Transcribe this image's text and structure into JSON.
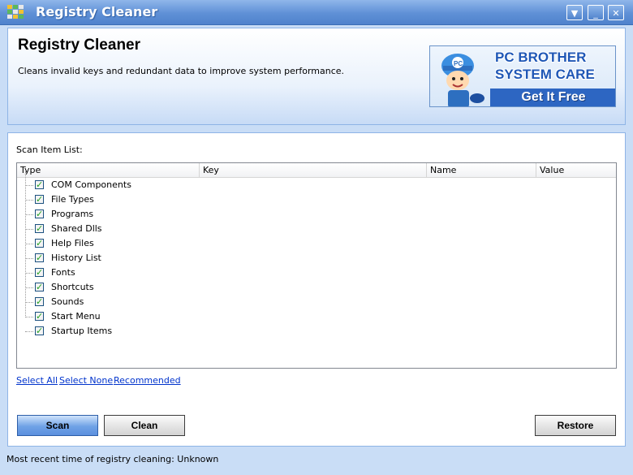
{
  "window": {
    "title": "Registry Cleaner",
    "controls": [
      "menu-down",
      "minimize",
      "close"
    ]
  },
  "header": {
    "title": "Registry Cleaner",
    "subtitle": "Cleans invalid keys and redundant data to improve system performance.",
    "ad": {
      "line1": "PC BROTHER",
      "line2": "SYSTEM CARE",
      "cta": "Get It Free"
    }
  },
  "scan": {
    "label": "Scan Item List:",
    "columns": [
      "Type",
      "Key",
      "Name",
      "Value"
    ],
    "items": [
      {
        "label": "COM Components",
        "checked": true
      },
      {
        "label": "File Types",
        "checked": true
      },
      {
        "label": "Programs",
        "checked": true
      },
      {
        "label": "Shared Dlls",
        "checked": true
      },
      {
        "label": "Help Files",
        "checked": true
      },
      {
        "label": "History List",
        "checked": true
      },
      {
        "label": "Fonts",
        "checked": true
      },
      {
        "label": "Shortcuts",
        "checked": true
      },
      {
        "label": "Sounds",
        "checked": true
      },
      {
        "label": "Start Menu",
        "checked": true
      },
      {
        "label": "Startup Items",
        "checked": true
      }
    ]
  },
  "links": {
    "select_all": "Select All",
    "select_none": "Select None",
    "recommended": "Recommended"
  },
  "buttons": {
    "scan": "Scan",
    "clean": "Clean",
    "restore": "Restore"
  },
  "status": "Most recent time of registry cleaning: Unknown",
  "colors": {
    "titlebar": "#5f90d6",
    "link": "#0033cc",
    "check": "#21a121"
  }
}
